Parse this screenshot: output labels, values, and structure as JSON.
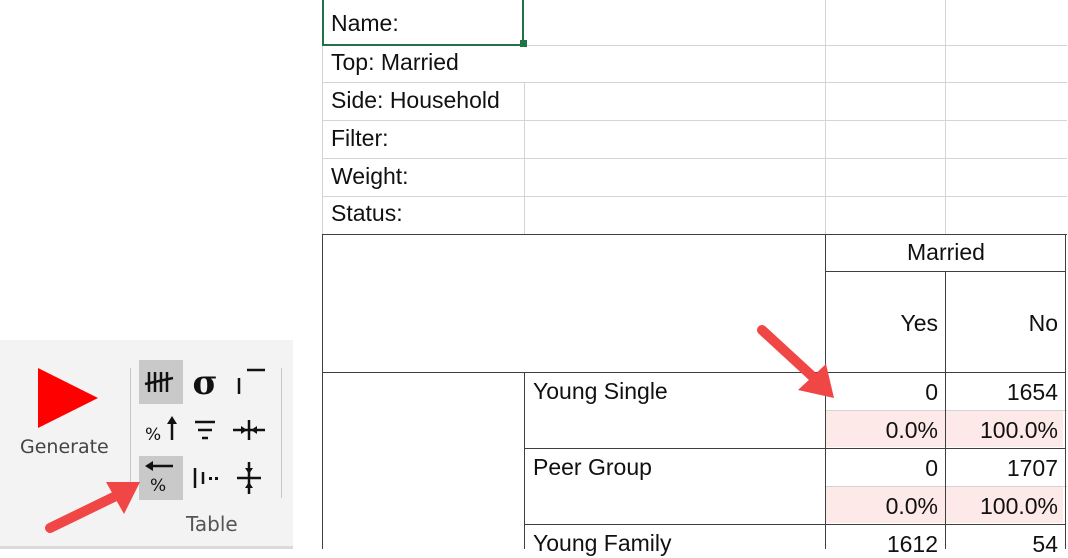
{
  "ribbon": {
    "generate_label": "Generate",
    "group_label": "Table",
    "tools": [
      {
        "icon": "tally-icon"
      },
      {
        "icon": "sigma-icon"
      },
      {
        "icon": "bar-top-icon"
      },
      {
        "icon": "percent-up-icon"
      },
      {
        "icon": "filter-icon"
      },
      {
        "icon": "merge-horizontal-icon"
      },
      {
        "icon": "percent-back-icon"
      },
      {
        "icon": "columns-icon"
      },
      {
        "icon": "merge-vertical-icon"
      }
    ]
  },
  "sheet": {
    "meta": [
      {
        "label": "Name:"
      },
      {
        "label": "Top: Married"
      },
      {
        "label": "Side: Household"
      },
      {
        "label": "Filter:"
      },
      {
        "label": "Weight:"
      },
      {
        "label": "Status:"
      }
    ],
    "top_header": "Married",
    "columns": [
      "Yes",
      "No"
    ],
    "rows": [
      {
        "label": "Young Single",
        "yes": "0",
        "no": "1654",
        "yes_pct": "0.0%",
        "no_pct": "100.0%"
      },
      {
        "label": "Peer Group",
        "yes": "0",
        "no": "1707",
        "yes_pct": "0.0%",
        "no_pct": "100.0%"
      },
      {
        "label": "Young Family",
        "yes": "1612",
        "no": "54"
      }
    ]
  },
  "colors": {
    "accent": "#ff0000",
    "highlight": "#fde9e7",
    "selection": "#217346",
    "arrow": "#f04646"
  }
}
